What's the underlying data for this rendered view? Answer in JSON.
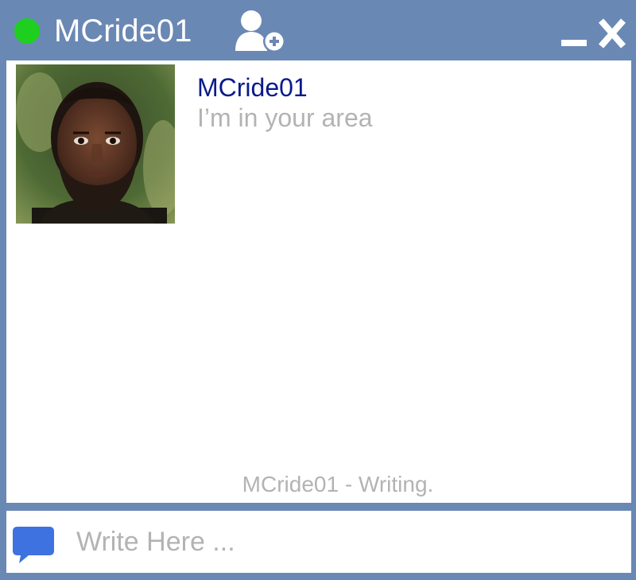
{
  "window": {
    "title": "MCride01",
    "status": "online",
    "status_color": "#1fcf1f",
    "frame_color": "#6a88b4",
    "controls": {
      "add_user_icon": "add-user-icon",
      "minimize_icon": "minimize-icon",
      "close_label": "X"
    }
  },
  "conversation": {
    "messages": [
      {
        "sender": "MCride01",
        "text": "I’m in your area",
        "avatar_icon": "user-avatar-photo"
      }
    ],
    "typing_indicator": "MCride01 - Writing."
  },
  "composer": {
    "placeholder": "Write Here ...",
    "value": "",
    "icon": "chat-bubble-icon",
    "icon_color": "#3d72e0"
  },
  "colors": {
    "sender_name": "#0a1a8c",
    "muted_text": "#b3b3b3"
  }
}
